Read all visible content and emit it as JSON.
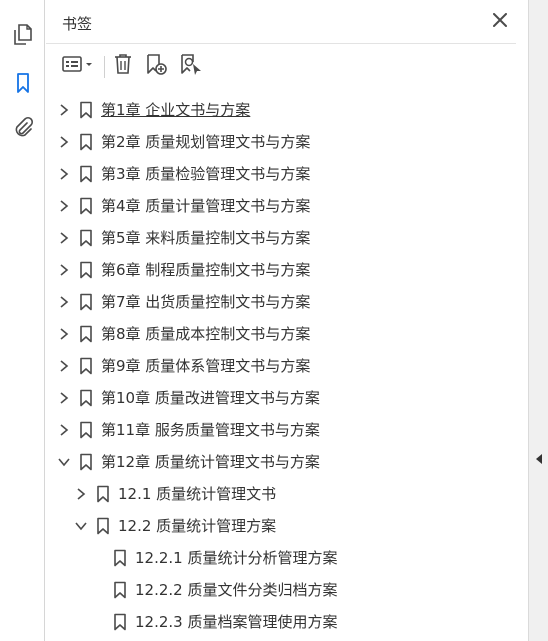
{
  "panel": {
    "title": "书签"
  },
  "toolbar": {
    "options_icon": "options-list-icon",
    "delete_icon": "trash-icon",
    "new_bookmark_icon": "new-bookmark-icon",
    "bookmark_from_selection_icon": "bookmark-search-icon"
  },
  "rail": {
    "items": [
      {
        "icon": "page-thumbnails-icon",
        "active": false
      },
      {
        "icon": "bookmark-icon",
        "active": true
      },
      {
        "icon": "attachment-icon",
        "active": false
      }
    ]
  },
  "bookmarks": [
    {
      "label": "第1章 企业文书与方案",
      "level": 0,
      "expanded": false,
      "selected": true
    },
    {
      "label": "第2章 质量规划管理文书与方案",
      "level": 0,
      "expanded": false
    },
    {
      "label": "第3章 质量检验管理文书与方案",
      "level": 0,
      "expanded": false
    },
    {
      "label": "第4章 质量计量管理文书与方案",
      "level": 0,
      "expanded": false
    },
    {
      "label": "第5章 来料质量控制文书与方案",
      "level": 0,
      "expanded": false
    },
    {
      "label": "第6章 制程质量控制文书与方案",
      "level": 0,
      "expanded": false
    },
    {
      "label": "第7章 出货质量控制文书与方案",
      "level": 0,
      "expanded": false
    },
    {
      "label": "第8章 质量成本控制文书与方案",
      "level": 0,
      "expanded": false
    },
    {
      "label": "第9章 质量体系管理文书与方案",
      "level": 0,
      "expanded": false
    },
    {
      "label": "第10章 质量改进管理文书与方案",
      "level": 0,
      "expanded": false
    },
    {
      "label": "第11章 服务质量管理文书与方案",
      "level": 0,
      "expanded": false
    },
    {
      "label": "第12章 质量统计管理文书与方案",
      "level": 0,
      "expanded": true
    },
    {
      "label": "12.1 质量统计管理文书",
      "level": 1,
      "expanded": false
    },
    {
      "label": "12.2 质量统计管理方案",
      "level": 1,
      "expanded": true
    },
    {
      "label": "12.2.1 质量统计分析管理方案",
      "level": 2,
      "leaf": true
    },
    {
      "label": "12.2.2 质量文件分类归档方案",
      "level": 2,
      "leaf": true
    },
    {
      "label": "12.2.3 质量档案管理使用方案",
      "level": 2,
      "leaf": true
    }
  ],
  "colors": {
    "accent": "#1473e6",
    "icon": "#4b4b4b",
    "text": "#333333"
  }
}
